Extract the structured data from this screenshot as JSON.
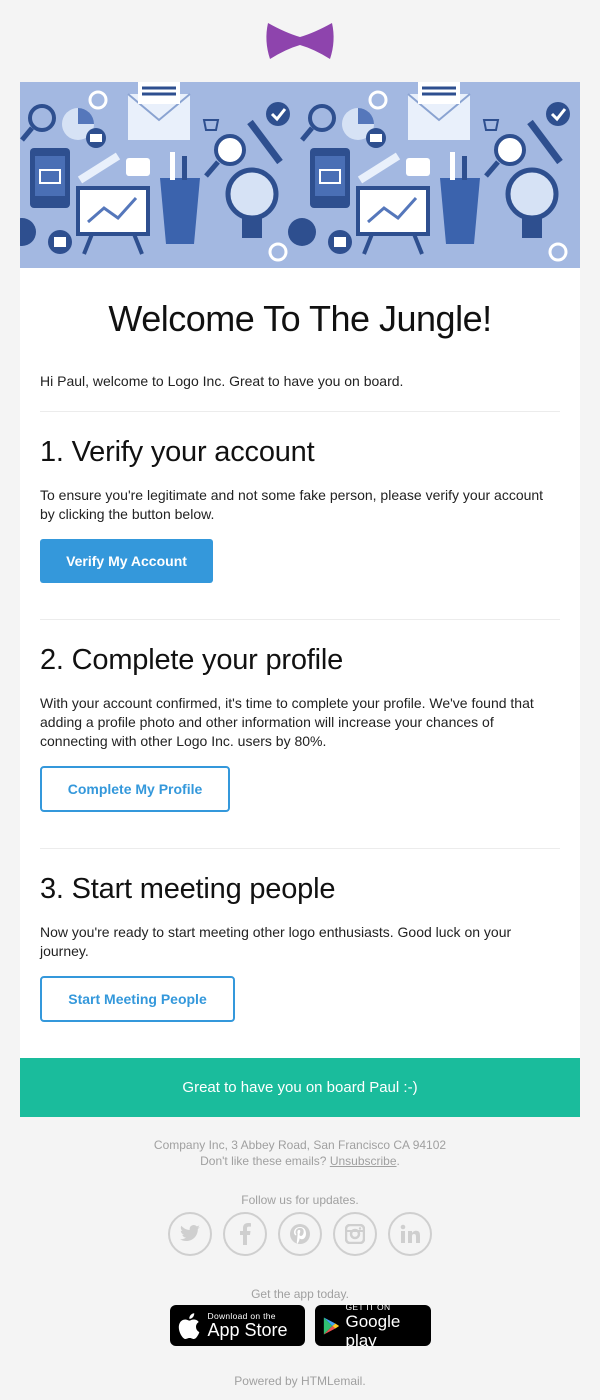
{
  "brand": {
    "logo_icon": "bowtie-icon",
    "color": "#8e44ad"
  },
  "hero": {
    "icon": "office-supplies-pattern",
    "bg": "#a3b8e1"
  },
  "title": "Welcome To The Jungle!",
  "greeting": "Hi Paul, welcome to Logo Inc. Great to have you on board.",
  "sections": [
    {
      "heading": "1. Verify your account",
      "body": "To ensure you're legitimate and not some fake person, please verify your account by clicking the button below.",
      "button": "Verify My Account"
    },
    {
      "heading": "2. Complete your profile",
      "body": "With your account confirmed, it's time to complete your profile. We've found that adding a profile photo and other information will increase your chances of connecting with other Logo Inc. users by 80%.",
      "button": "Complete My Profile"
    },
    {
      "heading": "3. Start meeting people",
      "body": "Now you're ready to start meeting other logo enthusiasts. Good luck on your journey.",
      "button": "Start Meeting People"
    }
  ],
  "banner": "Great to have you on board Paul :-)",
  "footer": {
    "address": "Company Inc, 3 Abbey Road, San Francisco CA 94102",
    "unsubscribe_prefix": "Don't like these emails? ",
    "unsubscribe_link": "Unsubscribe",
    "unsubscribe_suffix": ".",
    "follow": "Follow us for updates.",
    "socials": [
      "twitter-icon",
      "facebook-icon",
      "pinterest-icon",
      "instagram-icon",
      "linkedin-icon"
    ],
    "get_app": "Get the app today.",
    "app_store": {
      "small": "Download on the",
      "big": "App Store"
    },
    "google_play": {
      "small": "GET IT ON",
      "big": "Google play"
    },
    "powered": "Powered by HTMLemail."
  },
  "colors": {
    "primary": "#3498db",
    "teal": "#1abc9c",
    "footer_text": "#a0a0a0"
  }
}
